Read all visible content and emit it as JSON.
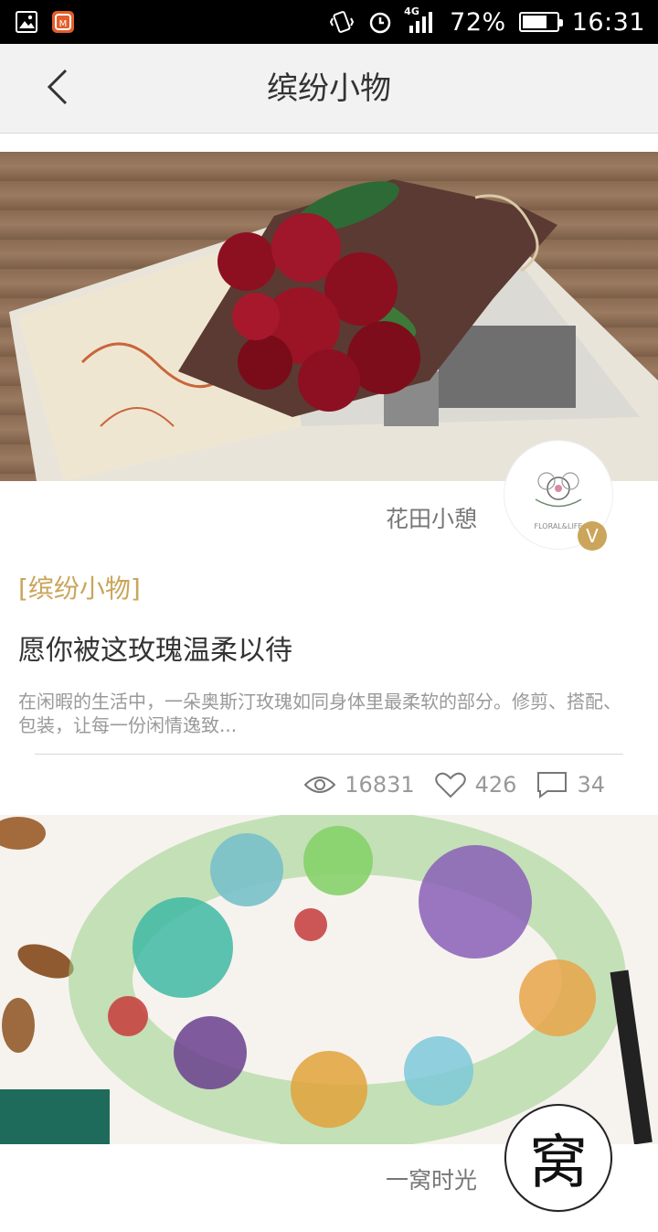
{
  "status_bar": {
    "signal_label": "4G",
    "battery_percent": "72%",
    "battery_level": 0.72,
    "time": "16:31",
    "icons": [
      "image-icon",
      "app-logo-icon",
      "vibrate-icon",
      "alarm-icon",
      "signal-icon",
      "battery-icon"
    ]
  },
  "header": {
    "title": "缤纷小物",
    "back_icon": "chevron-left-icon"
  },
  "cards": [
    {
      "image_name": "roses-bouquet-image",
      "author": "花田小憩",
      "avatar_text": "FLORAL&LIFE",
      "verified_label": "V",
      "category": "[缤纷小物]",
      "title": "愿你被这玫瑰温柔以待",
      "description": "在闲暇的生活中，一朵奥斯汀玫瑰如同身体里最柔软的部分。修剪、搭配、包装，让每一份闲情逸致...",
      "views": "16831",
      "likes": "426",
      "comments": "34"
    },
    {
      "image_name": "succulent-wreath-image",
      "author": "一窝时光",
      "avatar_text": "窝"
    }
  ],
  "colors": {
    "accent": "#caa55b",
    "title_text": "#333333",
    "muted_text": "#999999",
    "header_bg": "#f2f2f2"
  }
}
